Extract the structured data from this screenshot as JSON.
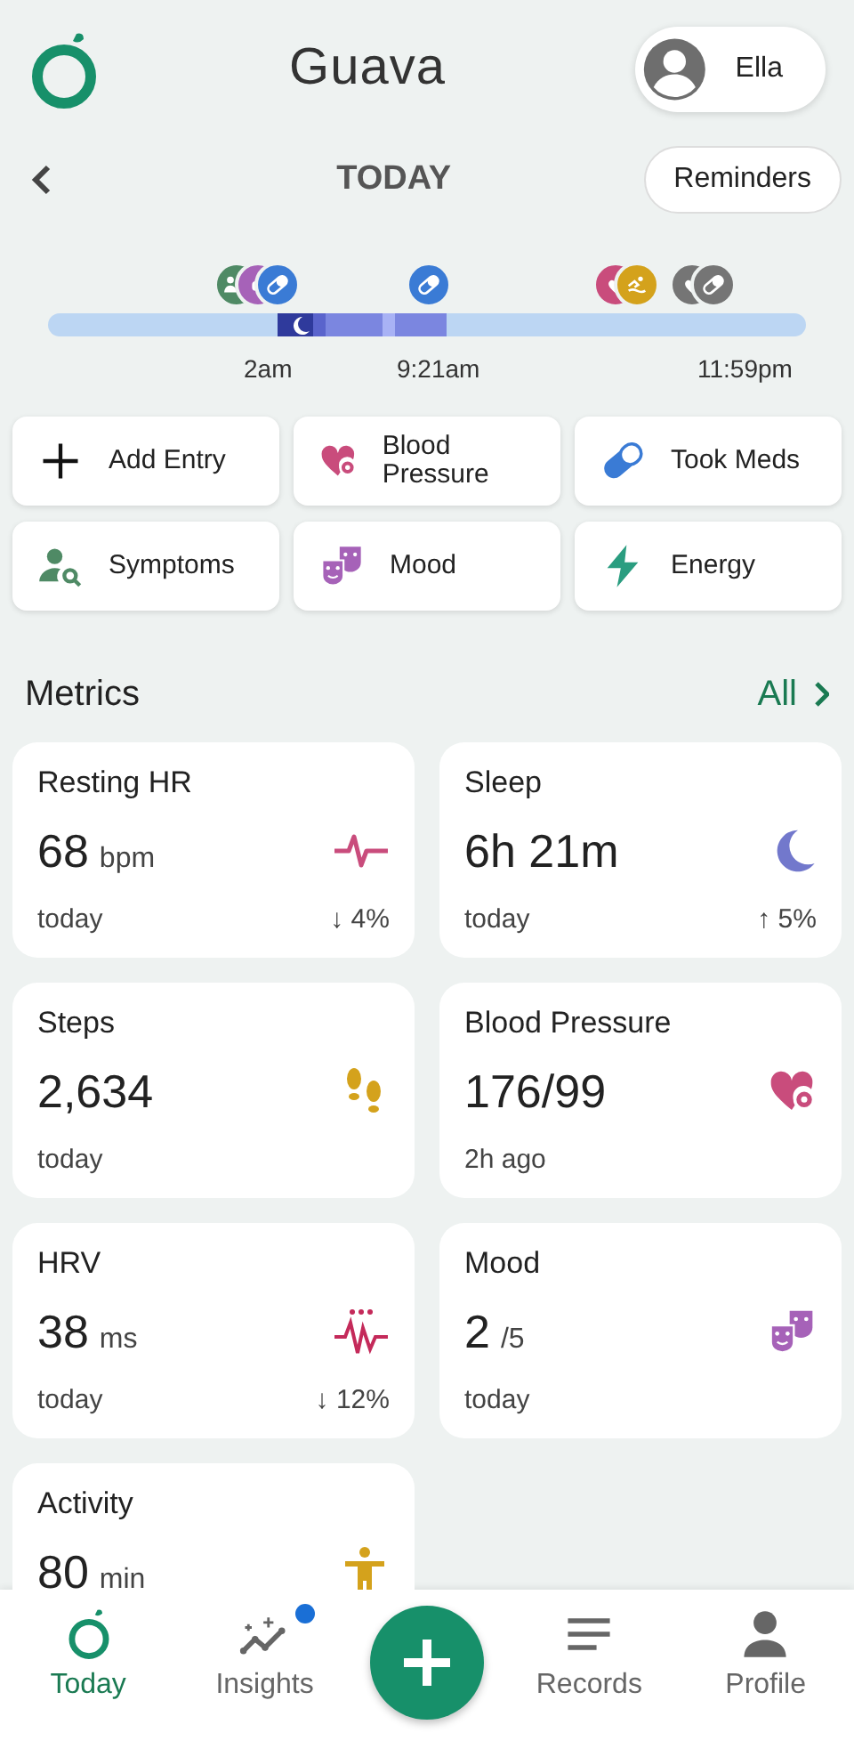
{
  "app": {
    "title": "Guava",
    "user": "Ella"
  },
  "day": {
    "label": "TODAY",
    "reminders": "Reminders"
  },
  "timeline": {
    "markers": [
      {
        "kind": "symptoms",
        "color": "#4f8a65"
      },
      {
        "kind": "mood",
        "color": "#a662b8"
      },
      {
        "kind": "meds",
        "color": "#3a7bd5"
      },
      {
        "kind": "meds",
        "color": "#3a7bd5"
      },
      {
        "kind": "heart",
        "color": "#c94c7c"
      },
      {
        "kind": "activity",
        "color": "#d4a21c"
      },
      {
        "kind": "heart",
        "color": "#757575"
      },
      {
        "kind": "meds",
        "color": "#757575"
      }
    ],
    "labels": [
      "2am",
      "9:21am",
      "11:59pm"
    ]
  },
  "actions": [
    {
      "kind": "add",
      "label": "Add Entry"
    },
    {
      "kind": "bp",
      "label": "Blood Pressure"
    },
    {
      "kind": "meds",
      "label": "Took Meds"
    },
    {
      "kind": "symptoms",
      "label": "Symptoms"
    },
    {
      "kind": "mood",
      "label": "Mood"
    },
    {
      "kind": "energy",
      "label": "Energy"
    }
  ],
  "metrics": {
    "title": "Metrics",
    "all": "All",
    "cards": [
      {
        "kind": "hr",
        "title": "Resting HR",
        "value": "68",
        "unit": "bpm",
        "note": "today",
        "change": "↓ 4%"
      },
      {
        "kind": "sleep",
        "title": "Sleep",
        "value": "6h 21m",
        "note": "today",
        "change": "↑ 5%"
      },
      {
        "kind": "steps",
        "title": "Steps",
        "value": "2,634",
        "note": "today"
      },
      {
        "kind": "bp",
        "title": "Blood Pressure",
        "value": "176/99",
        "note": "2h ago"
      },
      {
        "kind": "hrv",
        "title": "HRV",
        "value": "38",
        "unit": "ms",
        "note": "today",
        "change": "↓ 12%"
      },
      {
        "kind": "mood",
        "title": "Mood",
        "value": "2",
        "unit": "/5",
        "note": "today"
      },
      {
        "kind": "activity",
        "title": "Activity",
        "value": "80",
        "unit": "min"
      }
    ]
  },
  "nav": [
    {
      "kind": "today",
      "label": "Today",
      "selected": true,
      "notification": false
    },
    {
      "kind": "insights",
      "label": "Insights",
      "selected": false,
      "notification": true
    },
    {
      "kind": "fab"
    },
    {
      "kind": "records",
      "label": "Records",
      "selected": false,
      "notification": false
    },
    {
      "kind": "profile",
      "label": "Profile",
      "selected": false,
      "notification": false
    }
  ]
}
